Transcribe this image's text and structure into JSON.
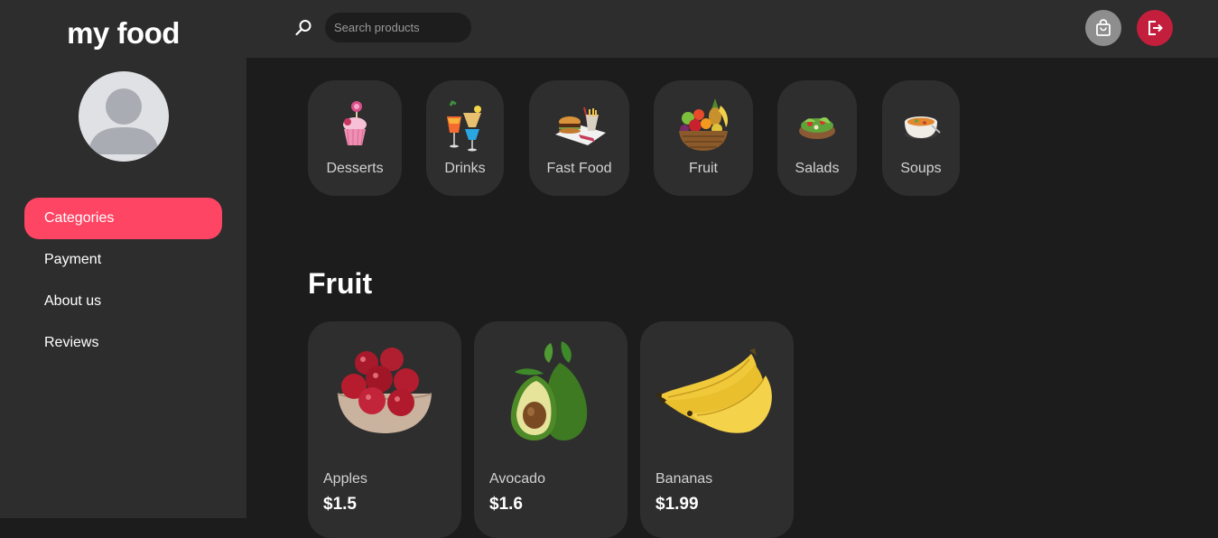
{
  "app": {
    "logo": "my food"
  },
  "sidebar": {
    "items": [
      {
        "label": "Categories",
        "active": true
      },
      {
        "label": "Payment",
        "active": false
      },
      {
        "label": "About us",
        "active": false
      },
      {
        "label": "Reviews",
        "active": false
      }
    ]
  },
  "header": {
    "search": {
      "placeholder": "Search products",
      "value": ""
    },
    "cart_icon": "shopping-bag-icon",
    "logout_icon": "logout-icon"
  },
  "categories": [
    {
      "label": "Desserts",
      "icon": "cupcake-icon"
    },
    {
      "label": "Drinks",
      "icon": "cocktail-icon"
    },
    {
      "label": "Fast Food",
      "icon": "burger-fries-icon"
    },
    {
      "label": "Fruit",
      "icon": "fruit-basket-icon"
    },
    {
      "label": "Salads",
      "icon": "salad-bowl-icon"
    },
    {
      "label": "Soups",
      "icon": "soup-bowl-icon"
    }
  ],
  "section": {
    "title": "Fruit"
  },
  "products": [
    {
      "name": "Apples",
      "price": "$1.5"
    },
    {
      "name": "Avocado",
      "price": "$1.6"
    },
    {
      "name": "Bananas",
      "price": "$1.99"
    }
  ],
  "colors": {
    "accent": "#ff4564",
    "logout": "#c41e3d",
    "sidebar_bg": "#2d2d2d",
    "main_bg": "#1c1c1c",
    "card_bg": "#2e2e2e"
  }
}
